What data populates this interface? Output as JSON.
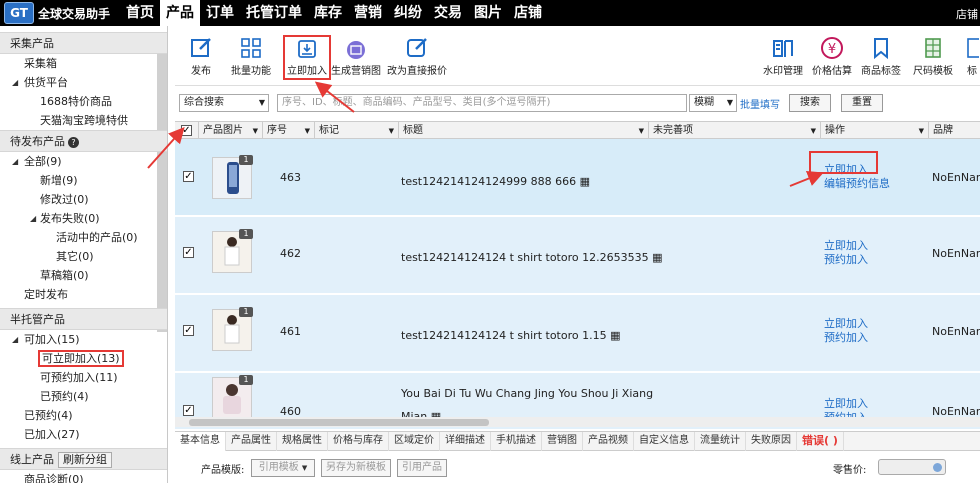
{
  "app": {
    "logo_badge": "GT",
    "title": "全球交易助手",
    "top_right": "店铺"
  },
  "nav": [
    "首页",
    "产品",
    "订单",
    "托管订单",
    "库存",
    "营销",
    "纠纷",
    "交易",
    "图片",
    "店铺"
  ],
  "sidebar": {
    "collect": {
      "header": "采集产品",
      "items": [
        "采集箱",
        "供货平台",
        "1688特价商品",
        "天猫淘宝跨境特供"
      ]
    },
    "pending": {
      "header": "待发布产品",
      "items": [
        "全部(9)",
        "新增(9)",
        "修改过(0)",
        "发布失败(0)",
        "活动中的产品(0)",
        "其它(0)",
        "草稿箱(0)",
        "定时发布"
      ]
    },
    "semi": {
      "header": "半托管产品",
      "items": [
        "可加入(15)",
        "可立即加入(13)",
        "可预约加入(11)",
        "已预约(4)",
        "已预约(4)",
        "已加入(27)"
      ]
    },
    "online": {
      "header": "线上产品",
      "refresh": "刷新分组",
      "items": [
        "商品诊断(0)"
      ]
    }
  },
  "toolbar": {
    "left": [
      "发布",
      "批量功能",
      "立即加入",
      "生成营销图",
      "改为直接报价"
    ],
    "right": [
      "水印管理",
      "价格估算",
      "商品标签",
      "尺码模板",
      "标"
    ]
  },
  "search": {
    "mode": "综合搜索",
    "placeholder": "序号、ID、标题、商品编码、产品型号、类目(多个逗号隔开)",
    "match": "模糊",
    "batch": "批量填写",
    "search_btn": "搜索",
    "reset_btn": "重置"
  },
  "columns": [
    "产品图片",
    "序号",
    "标记",
    "标题",
    "未完善项",
    "操作",
    "品牌"
  ],
  "rows": [
    {
      "badge": "1",
      "index": "463",
      "title": "test124214124124999 888 666",
      "ops": [
        "立即加入",
        "编辑预约信息"
      ],
      "brand": "NoEnName"
    },
    {
      "badge": "1",
      "index": "462",
      "title": "test124214124124 t shirt totoro 12.2653535",
      "ops": [
        "立即加入",
        "预约加入"
      ],
      "brand": "NoEnName"
    },
    {
      "badge": "1",
      "index": "461",
      "title": "test124214124124 t shirt totoro 1.15",
      "ops": [
        "立即加入",
        "预约加入"
      ],
      "brand": "NoEnName"
    },
    {
      "badge": "1",
      "index": "460",
      "title": "You Bai Di Tu Wu Chang Jing You Shou Ji Xiang",
      "title2": "Mian",
      "ops": [
        "立即加入",
        "预约加入"
      ],
      "brand": "NoEnName"
    }
  ],
  "tabs": [
    "基本信息",
    "产品属性",
    "规格属性",
    "价格与库存",
    "区域定价",
    "详细描述",
    "手机描述",
    "营销图",
    "产品视频",
    "自定义信息",
    "流量统计",
    "失败原因",
    "错误( )"
  ],
  "form": {
    "template_label": "产品模版:",
    "use_template": "引用模板",
    "save_template": "另存为新模板",
    "quote_product": "引用产品",
    "retail_label": "零售价:"
  },
  "colors": {
    "accent": "#1e6cc6",
    "highlight": "#e53935",
    "row_bg": "#d7ecf9"
  }
}
